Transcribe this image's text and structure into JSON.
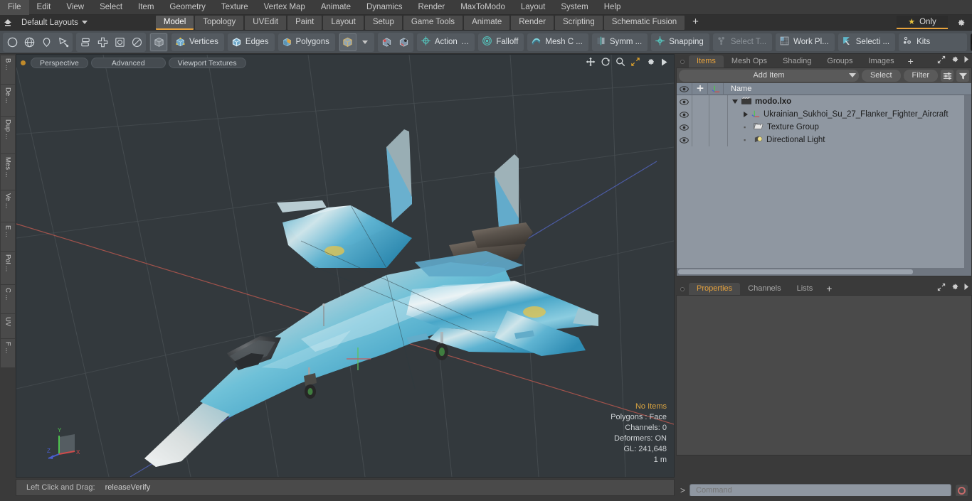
{
  "menubar": {
    "items": [
      "File",
      "Edit",
      "View",
      "Select",
      "Item",
      "Geometry",
      "Texture",
      "Vertex Map",
      "Animate",
      "Dynamics",
      "Render",
      "MaxToModo",
      "Layout",
      "System",
      "Help"
    ]
  },
  "layoutbar": {
    "layout_name": "Default Layouts",
    "tabs": [
      {
        "label": "Model",
        "active": true
      },
      {
        "label": "Topology",
        "active": false
      },
      {
        "label": "UVEdit",
        "active": false
      },
      {
        "label": "Paint",
        "active": false
      },
      {
        "label": "Layout",
        "active": false
      },
      {
        "label": "Setup",
        "active": false
      },
      {
        "label": "Game Tools",
        "active": false
      },
      {
        "label": "Animate",
        "active": false
      },
      {
        "label": "Render",
        "active": false
      },
      {
        "label": "Scripting",
        "active": false
      },
      {
        "label": "Schematic Fusion",
        "active": false
      }
    ],
    "add_tab_label": "+",
    "only_label": "Only",
    "accent_color": "#e8a33d"
  },
  "toolbar": {
    "shape_tools": [
      "circle-icon",
      "globe-icon",
      "pen-icon",
      "polygon-pen-icon"
    ],
    "transform_tools": [
      "mirror-icon",
      "move-icon",
      "scale-icon",
      "rotate-icon"
    ],
    "item_mode_icon": "cube-icon",
    "selection_modes": [
      {
        "label": "Vertices",
        "icon": "cube-vertices-icon"
      },
      {
        "label": "Edges",
        "icon": "cube-edges-icon"
      },
      {
        "label": "Polygons",
        "icon": "cube-polygons-icon"
      }
    ],
    "mode_dropdown_icon": "cube-item-icon",
    "snap_icons": [
      "snap-to-icon",
      "snap-from-icon"
    ],
    "buttons": [
      {
        "label": "Action",
        "icon": "action-center-icon",
        "truncated": true,
        "enabled": true
      },
      {
        "label": "Falloff",
        "icon": "falloff-icon",
        "truncated": false,
        "enabled": true
      },
      {
        "label": "Mesh C ...",
        "icon": "mesh-constraint-icon",
        "truncated": true,
        "enabled": true
      },
      {
        "label": "Symm ...",
        "icon": "symmetry-icon",
        "truncated": true,
        "enabled": true
      },
      {
        "label": "Snapping",
        "icon": "snapping-icon",
        "truncated": false,
        "enabled": true
      },
      {
        "label": "Select T...",
        "icon": "select-through-icon",
        "truncated": true,
        "enabled": false
      },
      {
        "label": "Work Pl...",
        "icon": "work-plane-icon",
        "truncated": true,
        "enabled": true
      },
      {
        "label": "Selecti ...",
        "icon": "selection-set-icon",
        "truncated": true,
        "enabled": true
      },
      {
        "label": "Kits",
        "icon": "kits-icon",
        "truncated": false,
        "enabled": true
      }
    ],
    "right_icons": [
      "modo-logo-icon",
      "unreal-logo-icon"
    ]
  },
  "left_tabs": [
    "B ...",
    "De ...",
    "Dup ...",
    "Mes ...",
    "Ve ...",
    "E ...",
    "Pol ...",
    "C ...",
    "UV",
    "F ..."
  ],
  "viewport": {
    "pills": [
      "Perspective",
      "Advanced",
      "Viewport Textures"
    ],
    "controls": [
      "pan-icon",
      "rotate-icon",
      "zoom-icon",
      "fit-icon",
      "gear-icon",
      "play-icon"
    ],
    "stats": {
      "selection": "No Items",
      "polygons": "Polygons : Face",
      "channels": "Channels: 0",
      "deformers": "Deformers: ON",
      "gl": "GL: 241,648",
      "scale": "1 m"
    },
    "axis_labels": {
      "x": "X",
      "y": "Y",
      "z": "Z"
    },
    "scene_object": "Ukrainian Sukhoi Su-27 Flanker fighter aircraft 3D model"
  },
  "statusbar": {
    "hint": "Left Click and Drag:",
    "command": "releaseVerify"
  },
  "right_panel": {
    "top_tabs": [
      {
        "label": "Items",
        "active": true
      },
      {
        "label": "Mesh Ops",
        "active": false
      },
      {
        "label": "Shading",
        "active": false
      },
      {
        "label": "Groups",
        "active": false
      },
      {
        "label": "Images",
        "active": false
      }
    ],
    "top_tabs_plus": "+",
    "item_bar": {
      "add_item": "Add Item",
      "select": "Select",
      "filter": "Filter",
      "list_icon": "list-options-icon",
      "funnel_icon": "funnel-icon"
    },
    "tree_header": {
      "eye_icon": "eye-icon",
      "lock_icon": "crosshair-icon",
      "axis_icon": "axis-icon",
      "name": "Name"
    },
    "tree_rows": [
      {
        "label": "modo.lxo",
        "icon": "scene-icon",
        "depth": 0,
        "expander": "down",
        "bold": true
      },
      {
        "label": "Ukrainian_Sukhoi_Su_27_Flanker_Fighter_Aircraft",
        "icon": "mesh-icon",
        "depth": 1,
        "expander": "right",
        "bold": false
      },
      {
        "label": "Texture Group",
        "icon": "folder-icon",
        "depth": 1,
        "expander": "none",
        "bold": false
      },
      {
        "label": "Directional Light",
        "icon": "light-icon",
        "depth": 1,
        "expander": "none",
        "bold": false
      }
    ],
    "bottom_tabs": [
      {
        "label": "Properties",
        "active": true
      },
      {
        "label": "Channels",
        "active": false
      },
      {
        "label": "Lists",
        "active": false
      }
    ],
    "bottom_tabs_plus": "+"
  },
  "command_line": {
    "prompt": ">",
    "placeholder": "Command",
    "record_icon": "record-icon"
  }
}
